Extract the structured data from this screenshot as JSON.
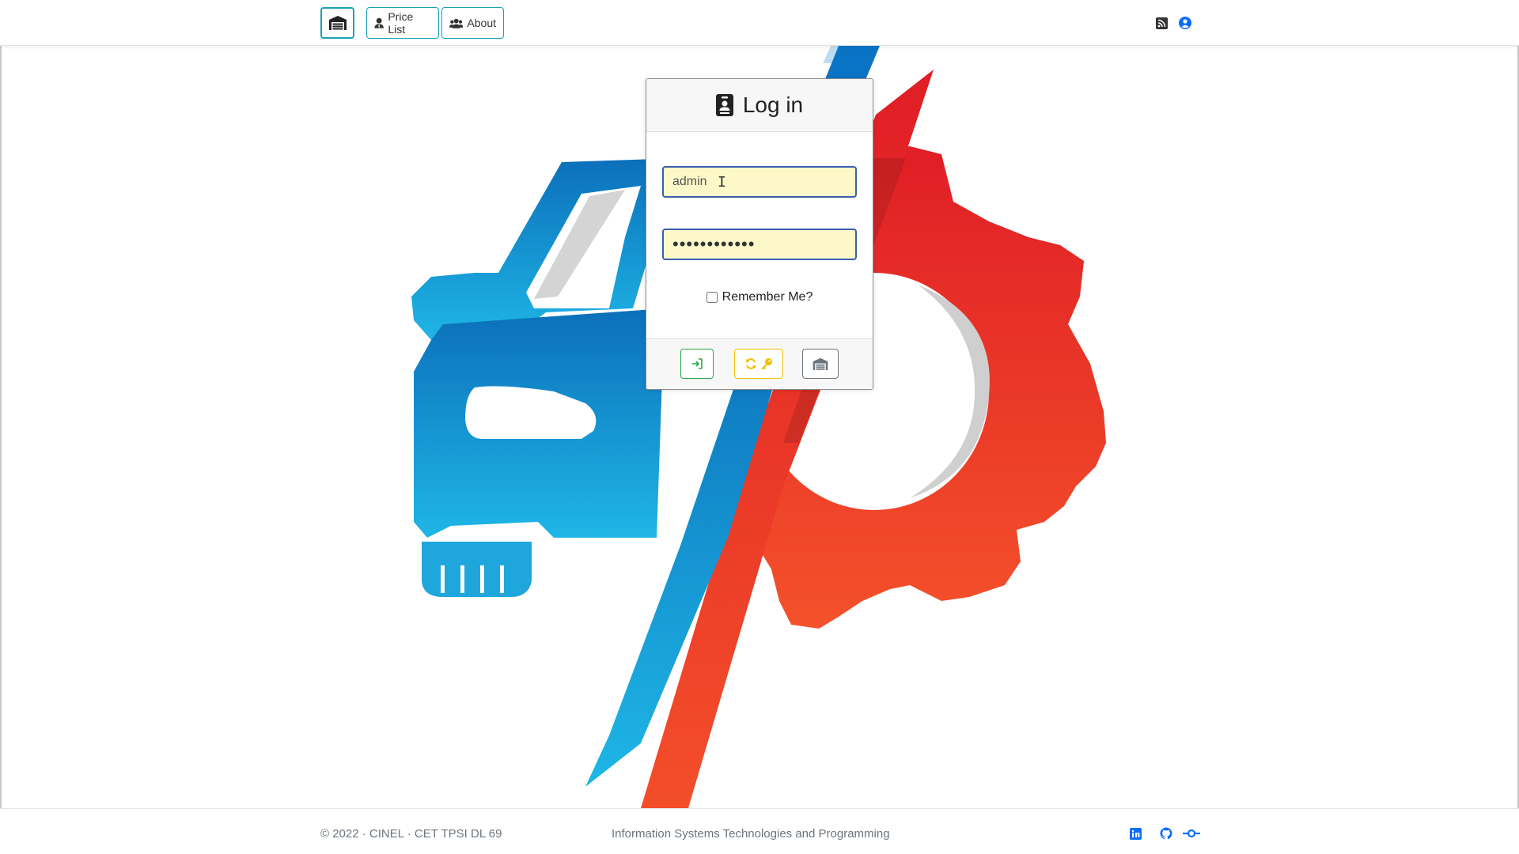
{
  "navbar": {
    "home_icon": "garage-icon",
    "price_list_label": "Price List",
    "price_list_icon": "user-tie-icon",
    "about_label": "About",
    "about_icon": "users-icon",
    "rss_icon": "rss-icon",
    "user_icon": "user-circle-icon"
  },
  "login": {
    "title": "Log in",
    "title_icon": "id-badge-icon",
    "username_value": "admin",
    "password_value": "••••••••••••",
    "remember_label": "Remember Me?",
    "remember_checked": false,
    "buttons": {
      "login_icon": "sign-in-icon",
      "reset_icons": [
        "sync-icon",
        "key-icon"
      ],
      "garage_icon": "garage-icon"
    }
  },
  "footer": {
    "copyright": "© 2022 · CINEL · CET TPSI DL 69",
    "subtitle": "Information Systems Technologies and Programming",
    "icons": [
      "linkedin-icon",
      "github-icon",
      "git-commit-icon"
    ]
  },
  "colors": {
    "accent_info": "#17a2b8",
    "success": "#28a745",
    "warning": "#f0c000",
    "secondary": "#6c757d",
    "link_blue": "#0d6efd",
    "autofill_yellow": "#fcf8c8",
    "logo_blue": "#1a8fd0",
    "logo_red": "#e8352a"
  }
}
